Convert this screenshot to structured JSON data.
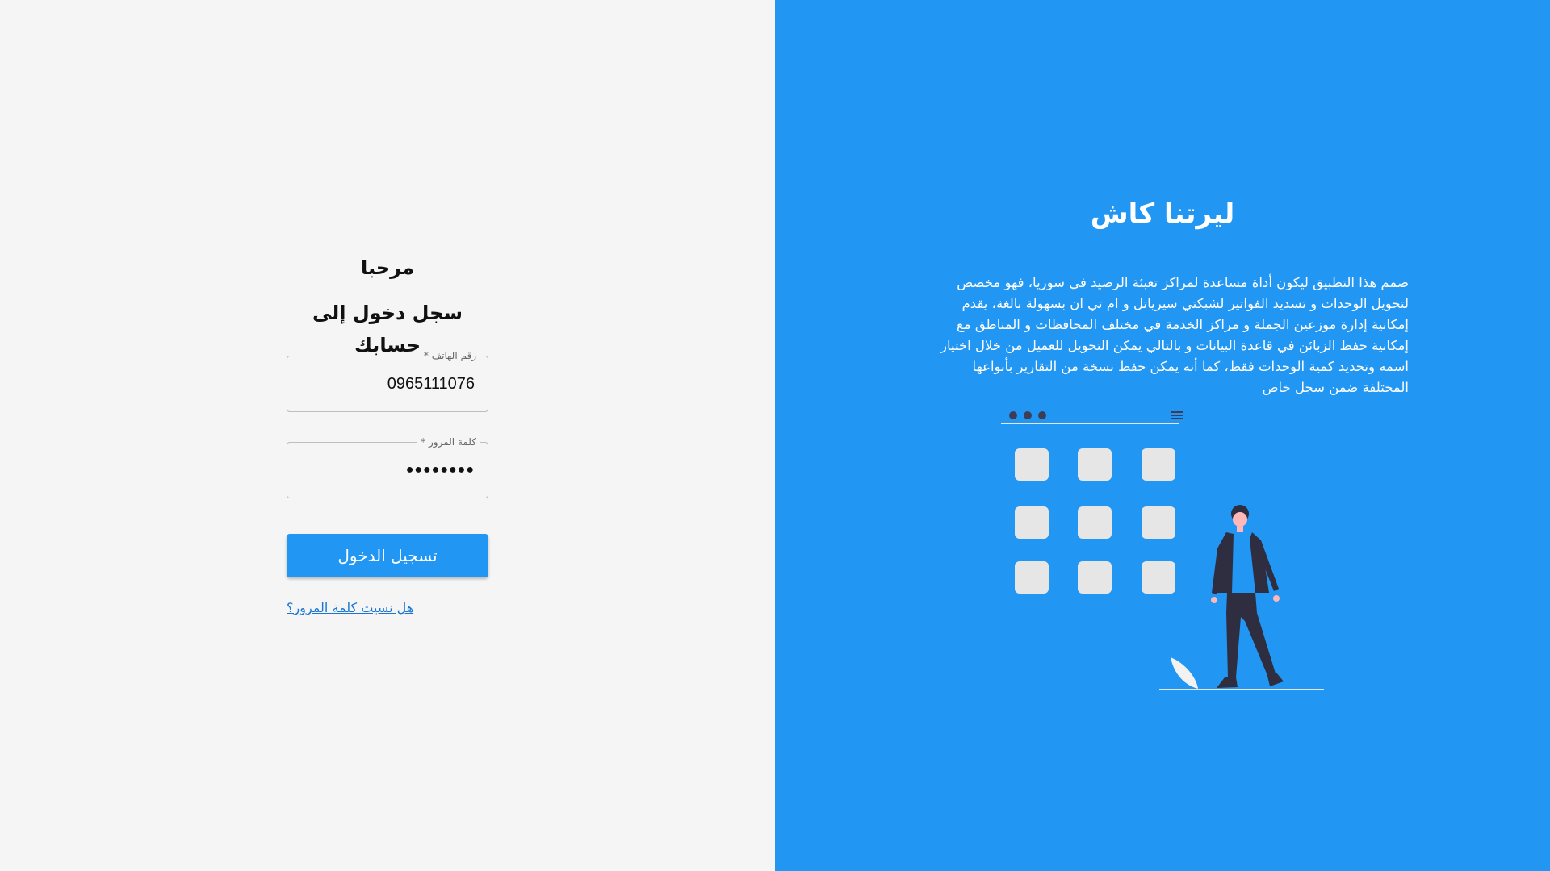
{
  "login": {
    "greeting": "مرحبا",
    "subtitle": "سجل دخول إلى حسابك",
    "phone_label": "رقم الهاتف *",
    "phone_value": "0965111076",
    "password_label": "كلمة المرور *",
    "password_masked": "●●●●●●●●",
    "submit_label": "تسجيل الدخول",
    "forgot_link": "هل نسيت كلمة المرور؟"
  },
  "info": {
    "app_name": "ليرتنا كاش",
    "description": "صمم هذا التطبيق ليكون أداة مساعدة لمراكز تعبئة الرصيد في سوريا، فهو مخصص لتحويل الوحدات و تسديد الفواتير لشبكتي سيرياتل و ام تي ان بسهولة بالغة، يقدم إمكانية إدارة موزعين الجملة و مراكز الخدمة في مختلف المحافظات و المناطق مع إمكانية حفظ الزبائن في قاعدة البيانات و بالتالي يمكن التحويل للعميل من خلال اختيار اسمه وتحديد كمية الوحدات فقط، كما أنه يمكن حفظ نسخة من التقارير بأنواعها المختلفة ضمن سجل خاص"
  },
  "colors": {
    "accent": "#2196f3",
    "left_background": "#f5f5f5",
    "link": "#1976d2"
  },
  "illustration": {
    "name": "person-with-app-grid",
    "icons": [
      "dots-icon",
      "hamburger-icon",
      "leaf-icon"
    ]
  }
}
